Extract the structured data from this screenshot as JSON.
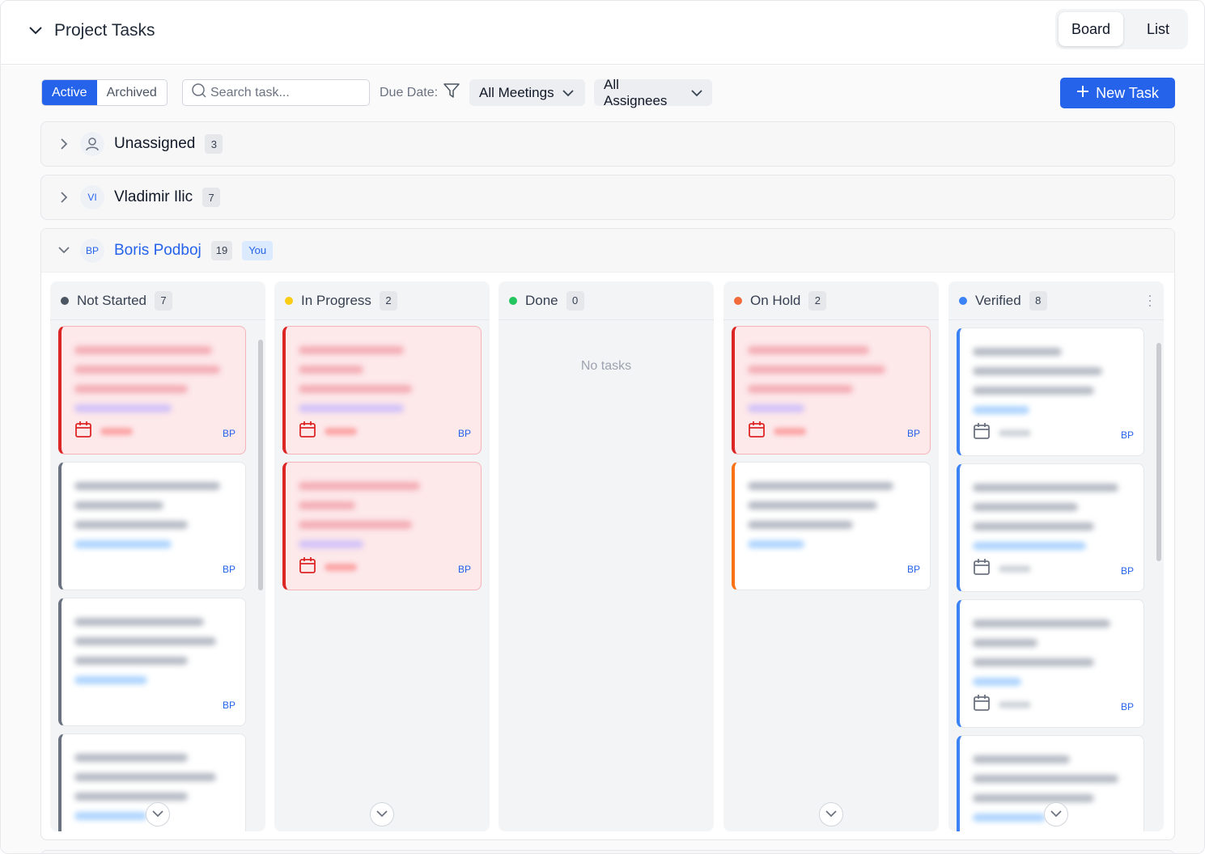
{
  "header": {
    "title": "Project Tasks",
    "views": [
      "Board",
      "List"
    ],
    "active_view": "Board"
  },
  "toolbar": {
    "status_tabs": [
      "Active",
      "Archived"
    ],
    "active_tab": "Active",
    "search_placeholder": "Search task...",
    "due_date_label": "Due Date:",
    "meetings_filter": "All Meetings",
    "assignees_filter": "All Assignees",
    "new_task_label": "New Task"
  },
  "groups": [
    {
      "name": "Unassigned",
      "count": "3",
      "avatar": ""
    },
    {
      "name": "Vladimir Ilic",
      "count": "7",
      "avatar": "VI"
    },
    {
      "name": "Boris Podboj",
      "count": "19",
      "avatar": "BP",
      "badge": "You"
    }
  ],
  "columns": [
    {
      "name": "Not Started",
      "count": "7",
      "color": "#6b7280"
    },
    {
      "name": "In Progress",
      "count": "2",
      "color": "#facc15"
    },
    {
      "name": "Done",
      "count": "0",
      "color": "#22c55e",
      "empty_text": "No tasks"
    },
    {
      "name": "On Hold",
      "count": "2",
      "color": "#f97316"
    },
    {
      "name": "Verified",
      "count": "8",
      "color": "#3b82f6"
    }
  ],
  "card_assignee": "BP",
  "colors": {
    "accent": "#2563eb",
    "overdue": "#dc2626"
  }
}
